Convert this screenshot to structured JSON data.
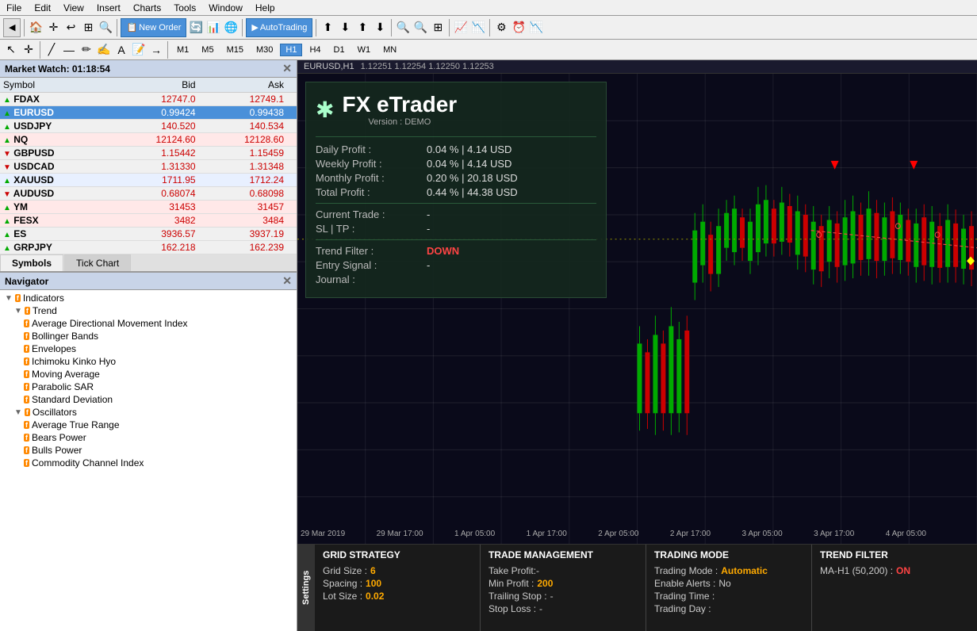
{
  "menubar": {
    "items": [
      "File",
      "Edit",
      "View",
      "Insert",
      "Charts",
      "Tools",
      "Window",
      "Help"
    ]
  },
  "toolbar": {
    "new_order_label": "New Order",
    "autotrading_label": "AutoTrading"
  },
  "timeframes": [
    "M1",
    "M5",
    "M15",
    "M30",
    "H1",
    "H4",
    "D1",
    "W1",
    "MN"
  ],
  "active_tf": "H1",
  "market_watch": {
    "title": "Market Watch: 01:18:54",
    "columns": [
      "Symbol",
      "Bid",
      "Ask"
    ],
    "rows": [
      {
        "symbol": "FDAX",
        "bid": "12747.0",
        "ask": "12749.1",
        "dir": "up",
        "style": ""
      },
      {
        "symbol": "EURUSD",
        "bid": "0.99424",
        "ask": "0.99438",
        "dir": "up",
        "style": "selected"
      },
      {
        "symbol": "USDJPY",
        "bid": "140.520",
        "ask": "140.534",
        "dir": "up",
        "style": ""
      },
      {
        "symbol": "NQ",
        "bid": "12124.60",
        "ask": "12128.60",
        "dir": "up",
        "style": "pink"
      },
      {
        "symbol": "GBPUSD",
        "bid": "1.15442",
        "ask": "1.15459",
        "dir": "down",
        "style": ""
      },
      {
        "symbol": "USDCAD",
        "bid": "1.31330",
        "ask": "1.31348",
        "dir": "down",
        "style": ""
      },
      {
        "symbol": "XAUUSD",
        "bid": "1711.95",
        "ask": "1712.24",
        "dir": "up",
        "style": "blue"
      },
      {
        "symbol": "AUDUSD",
        "bid": "0.68074",
        "ask": "0.68098",
        "dir": "down",
        "style": ""
      },
      {
        "symbol": "YM",
        "bid": "31453",
        "ask": "31457",
        "dir": "up",
        "style": "pink"
      },
      {
        "symbol": "FESX",
        "bid": "3482",
        "ask": "3484",
        "dir": "up",
        "style": "pink"
      },
      {
        "symbol": "ES",
        "bid": "3936.57",
        "ask": "3937.19",
        "dir": "up",
        "style": ""
      },
      {
        "symbol": "GRPJPY",
        "bid": "162.218",
        "ask": "162.239",
        "dir": "up",
        "style": ""
      }
    ]
  },
  "tabs": {
    "items": [
      "Symbols",
      "Tick Chart"
    ],
    "active": "Symbols"
  },
  "navigator": {
    "title": "Navigator",
    "tree": [
      {
        "level": 0,
        "type": "root",
        "label": "Indicators",
        "expanded": true
      },
      {
        "level": 1,
        "type": "folder",
        "label": "Trend",
        "expanded": true
      },
      {
        "level": 2,
        "type": "item",
        "label": "Average Directional Movement Index"
      },
      {
        "level": 2,
        "type": "item",
        "label": "Bollinger Bands"
      },
      {
        "level": 2,
        "type": "item",
        "label": "Envelopes"
      },
      {
        "level": 2,
        "type": "item",
        "label": "Ichimoku Kinko Hyo"
      },
      {
        "level": 2,
        "type": "item",
        "label": "Moving Average"
      },
      {
        "level": 2,
        "type": "item",
        "label": "Parabolic SAR"
      },
      {
        "level": 2,
        "type": "item",
        "label": "Standard Deviation"
      },
      {
        "level": 1,
        "type": "folder",
        "label": "Oscillators",
        "expanded": true
      },
      {
        "level": 2,
        "type": "item",
        "label": "Average True Range"
      },
      {
        "level": 2,
        "type": "item",
        "label": "Bears Power"
      },
      {
        "level": 2,
        "type": "item",
        "label": "Bulls Power"
      },
      {
        "level": 2,
        "type": "item",
        "label": "Commodity Channel Index"
      }
    ]
  },
  "chart": {
    "symbol": "EURUSD,H1",
    "prices": "1.12251  1.12254  1.12250  1.12253"
  },
  "fx_etrader": {
    "title": "FX eTrader",
    "version": "Version : DEMO",
    "daily_profit_label": "Daily Profit :",
    "daily_profit_value": "0.04 % | 4.14 USD",
    "weekly_profit_label": "Weekly Profit :",
    "weekly_profit_value": "0.04 % | 4.14 USD",
    "monthly_profit_label": "Monthly Profit :",
    "monthly_profit_value": "0.20 % | 20.18 USD",
    "total_profit_label": "Total Profit :",
    "total_profit_value": "0.44 % | 44.38 USD",
    "current_trade_label": "Current Trade :",
    "current_trade_value": "-",
    "sl_tp_label": "SL | TP :",
    "sl_tp_value": "-",
    "trend_filter_label": "Trend Filter :",
    "trend_filter_value": "DOWN",
    "entry_signal_label": "Entry Signal :",
    "entry_signal_value": "-",
    "journal_label": "Journal :"
  },
  "settings": {
    "label": "Settings",
    "grid_strategy": {
      "title": "GRID STRATEGY",
      "grid_size_label": "Grid Size :",
      "grid_size_value": "6",
      "spacing_label": "Spacing :",
      "spacing_value": "100",
      "lot_size_label": "Lot Size :",
      "lot_size_value": "0.02"
    },
    "trade_management": {
      "title": "TRADE MANAGEMENT",
      "take_profit_label": "Take Profit:-",
      "min_profit_label": "Min Profit :",
      "min_profit_value": "200",
      "trailing_stop_label": "Trailing Stop :",
      "trailing_stop_value": "-",
      "stop_loss_label": "Stop Loss :",
      "stop_loss_value": "-"
    },
    "trading_mode": {
      "title": "TRADING MODE",
      "mode_label": "Trading Mode :",
      "mode_value": "Automatic",
      "alerts_label": "Enable Alerts :",
      "alerts_value": "No",
      "time_label": "Trading Time :",
      "time_value": "",
      "day_label": "Trading Day :",
      "day_value": ""
    },
    "trend_filter": {
      "title": "TREND FILTER",
      "ma_label": "MA-H1 (50,200) :",
      "ma_value": "ON"
    }
  },
  "time_labels": [
    "29 Mar 2019",
    "29 Mar 17:00",
    "1 Apr 05:00",
    "1 Apr 17:00",
    "2 Apr 05:00",
    "2 Apr 17:00",
    "3 Apr 05:00",
    "3 Apr 17:00",
    "4 Apr 05:00"
  ]
}
